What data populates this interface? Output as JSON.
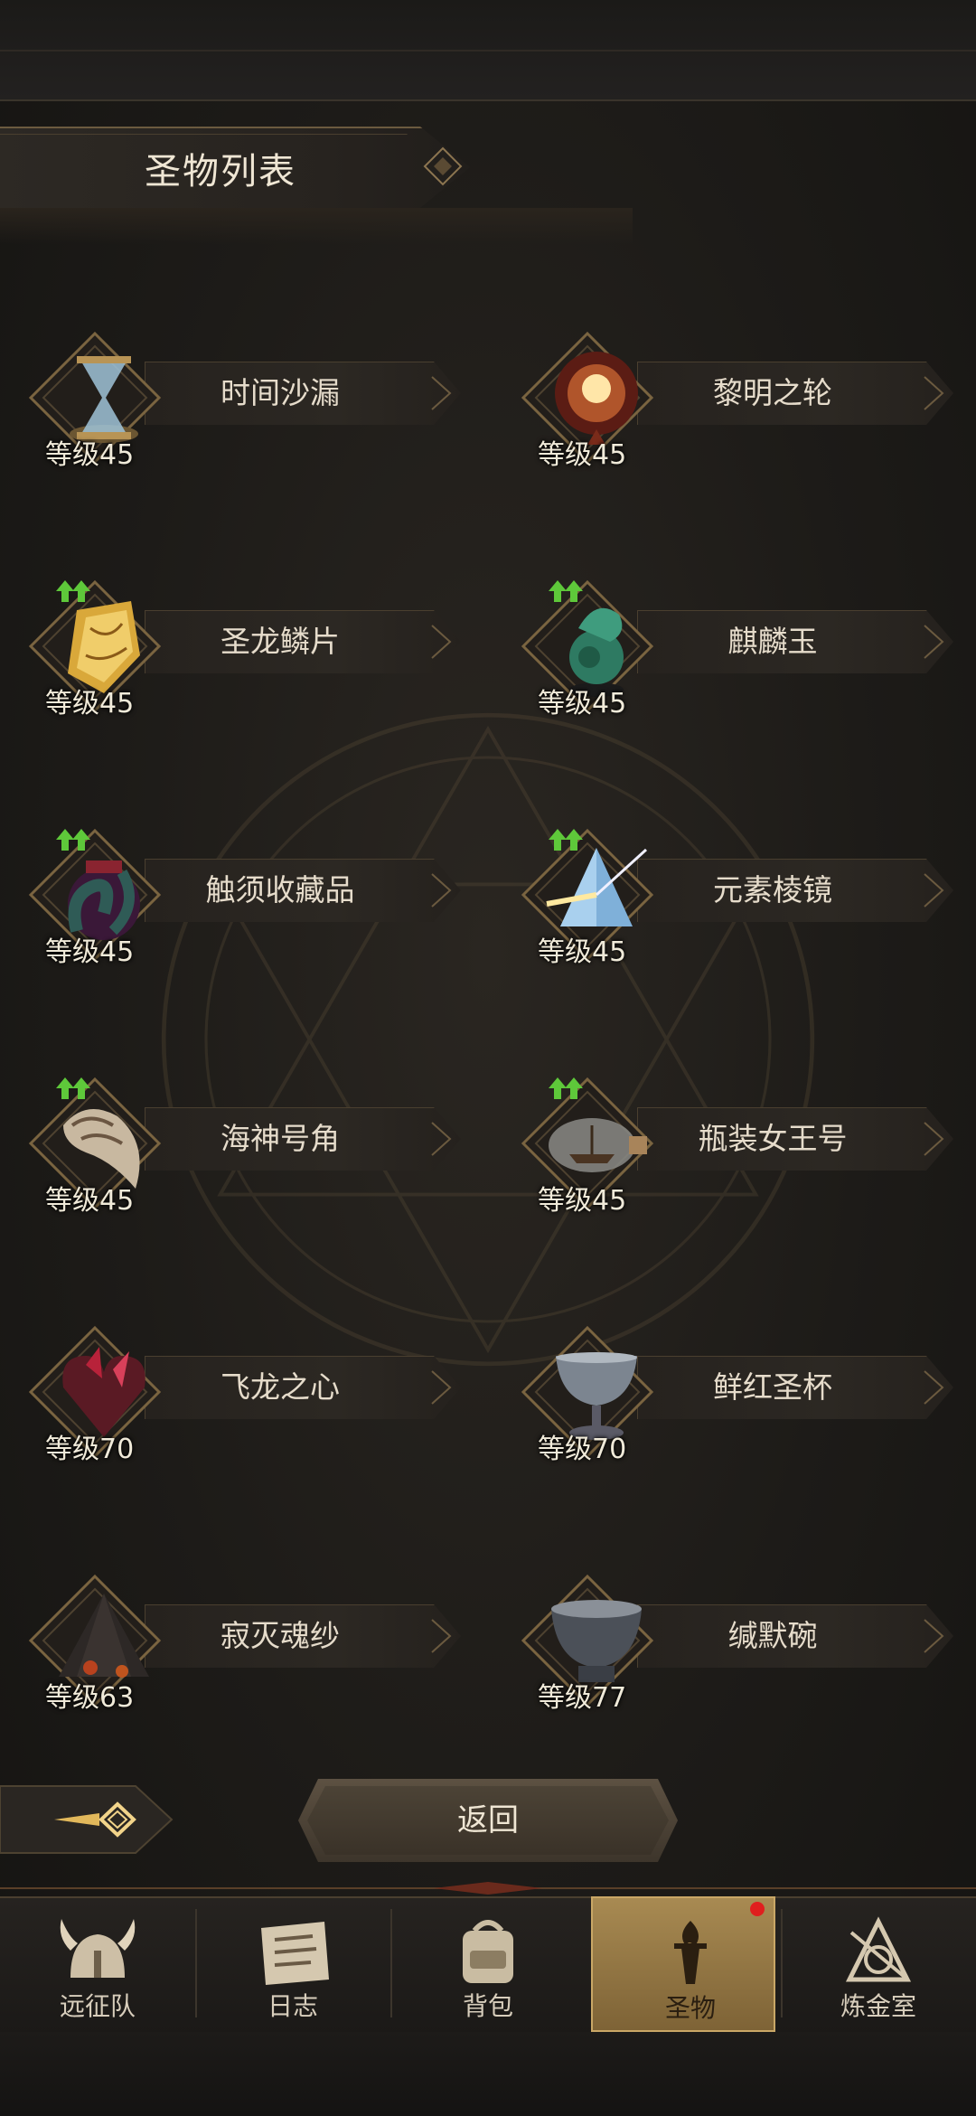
{
  "header": {
    "title": "圣物列表"
  },
  "relics": [
    {
      "name": "时间沙漏",
      "level": "等级45",
      "upgrade": false,
      "icon": "hourglass-icon"
    },
    {
      "name": "黎明之轮",
      "level": "等级45",
      "upgrade": false,
      "icon": "dawn-wheel-icon"
    },
    {
      "name": "圣龙鳞片",
      "level": "等级45",
      "upgrade": true,
      "icon": "dragon-scale-icon"
    },
    {
      "name": "麒麟玉",
      "level": "等级45",
      "upgrade": true,
      "icon": "qilin-jade-icon"
    },
    {
      "name": "触须收藏品",
      "level": "等级45",
      "upgrade": true,
      "icon": "tentacle-icon"
    },
    {
      "name": "元素棱镜",
      "level": "等级45",
      "upgrade": true,
      "icon": "prism-icon"
    },
    {
      "name": "海神号角",
      "level": "等级45",
      "upgrade": true,
      "icon": "conch-horn-icon"
    },
    {
      "name": "瓶装女王号",
      "level": "等级45",
      "upgrade": true,
      "icon": "ship-bottle-icon"
    },
    {
      "name": "飞龙之心",
      "level": "等级70",
      "upgrade": false,
      "icon": "dragon-heart-icon"
    },
    {
      "name": "鲜红圣杯",
      "level": "等级70",
      "upgrade": false,
      "icon": "chalice-icon"
    },
    {
      "name": "寂灭魂纱",
      "level": "等级63",
      "upgrade": false,
      "icon": "soul-veil-icon"
    },
    {
      "name": "缄默碗",
      "level": "等级77",
      "upgrade": false,
      "icon": "silent-bowl-icon"
    }
  ],
  "back_button": {
    "label": "返回"
  },
  "tabs": [
    {
      "label": "远征队",
      "icon": "viking-helmet-icon",
      "active": false
    },
    {
      "label": "日志",
      "icon": "journal-icon",
      "active": false
    },
    {
      "label": "背包",
      "icon": "backpack-icon",
      "active": false
    },
    {
      "label": "圣物",
      "icon": "torch-relic-icon",
      "active": true,
      "notification": true
    },
    {
      "label": "炼金室",
      "icon": "alchemy-icon",
      "active": false
    }
  ],
  "colors": {
    "accent_gold": "#c9a766",
    "upgrade_green": "#5ec83a",
    "badge_red": "#e01e1e"
  }
}
